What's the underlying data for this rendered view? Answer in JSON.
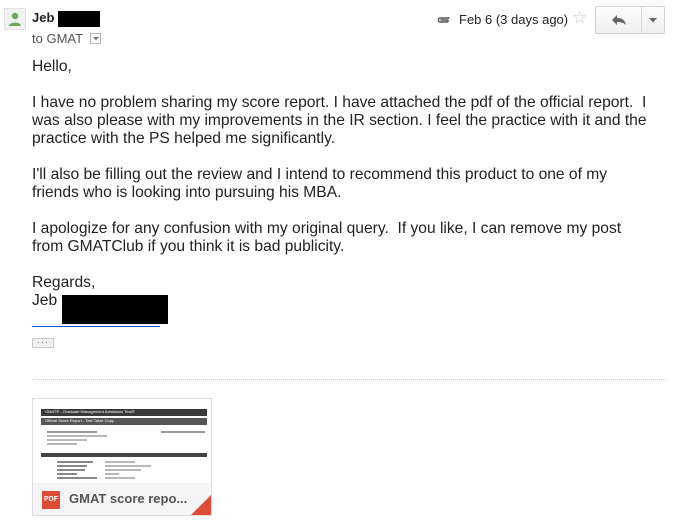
{
  "header": {
    "sender_name": "Jeb",
    "recipient": "to GMAT",
    "date": "Feb 6 (3 days ago)"
  },
  "message": {
    "paragraphs": [
      "Hello,",
      "I have no problem sharing my score report. I have attached the pdf of the official report.  I was also please with my improvements in the IR section. I feel the practice with it and the practice with the PS helped me significantly.",
      "I'll also be filling out the review and I intend to recommend this product to one of my friends who is looking into pursuing his MBA.",
      "I apologize for any confusion with my original query.  If you like, I can remove my post from GMATClub if you think it is bad publicity."
    ],
    "closing": "Regards,",
    "signature_name": "Jeb"
  },
  "attachment": {
    "file_name": "GMAT score repo...",
    "file_type": "PDF",
    "thumbnail_title": "GMAT® - Graduate Management Admission Test®",
    "thumbnail_subtitle": "Official Score Report - Test Taker Copy"
  },
  "icons": {
    "avatar": "person-icon",
    "attachment": "paperclip-icon",
    "star": "star-icon",
    "reply": "reply-arrow-icon",
    "more": "chevron-down-icon"
  },
  "colors": {
    "link": "#1155cc",
    "pdf": "#dd4b39",
    "avatar_person": "#6aa85c"
  }
}
